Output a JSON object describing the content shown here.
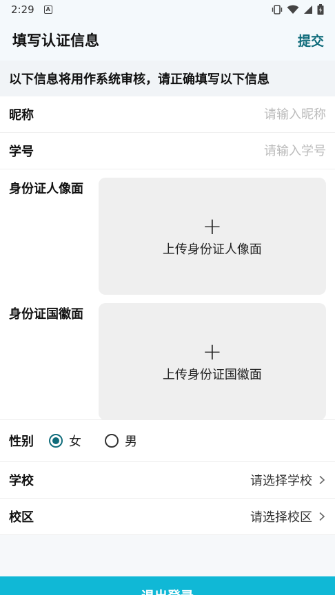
{
  "status_bar": {
    "time": "2:29",
    "notification_icon": "A"
  },
  "header": {
    "title": "填写认证信息",
    "submit_label": "提交"
  },
  "notice": "以下信息将用作系统审核，请正确填写以下信息",
  "form": {
    "nickname": {
      "label": "昵称",
      "placeholder": "请输入昵称"
    },
    "student_id": {
      "label": "学号",
      "placeholder": "请输入学号"
    },
    "id_front": {
      "label": "身份证人像面",
      "plus": "+",
      "hint": "上传身份证人像面"
    },
    "id_back": {
      "label": "身份证国徽面",
      "plus": "+",
      "hint": "上传身份证国徽面"
    },
    "gender": {
      "label": "性别",
      "options": [
        "女",
        "男"
      ],
      "selected": "女"
    },
    "school": {
      "label": "学校",
      "value": "请选择学校"
    },
    "campus": {
      "label": "校区",
      "value": "请选择校区"
    }
  },
  "logout_label": "退出登录",
  "colors": {
    "accent": "#0e6b7a",
    "button": "#10b8d6"
  }
}
